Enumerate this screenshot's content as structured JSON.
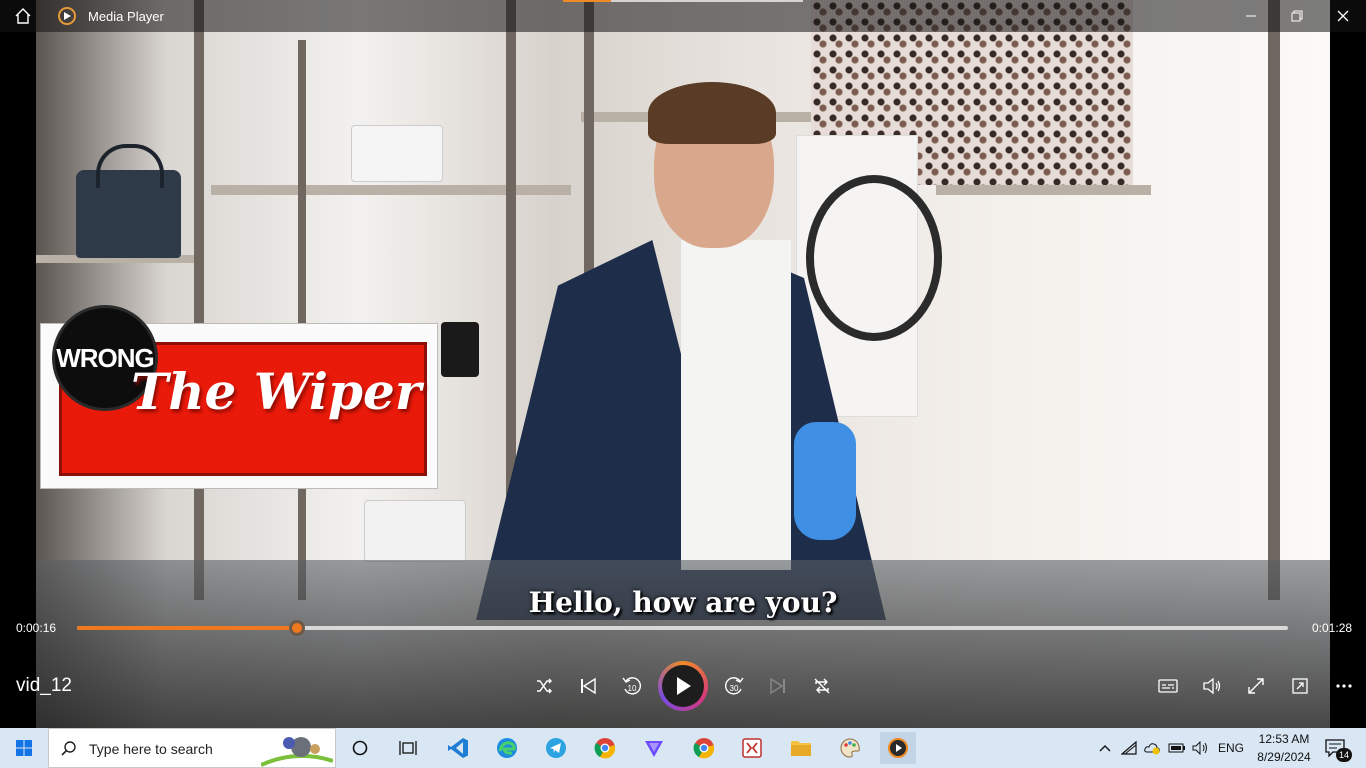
{
  "window": {
    "title": "Media Player"
  },
  "video": {
    "logo_badge": "WRONG",
    "logo_title": "The Wiper",
    "subtitle": "Hello, how are you?"
  },
  "playback": {
    "current_time": "0:00:16",
    "total_time": "0:01:28",
    "progress": 0.1818,
    "media_name": "vid_12",
    "rewind_label": "10",
    "forward_label": "30"
  },
  "taskbar": {
    "search_placeholder": "Type here to search",
    "language": "ENG",
    "time": "12:53 AM",
    "date": "8/29/2024",
    "notification_count": "14"
  },
  "colors": {
    "accent": "#f0781f",
    "taskbar": "#d9e6f3"
  }
}
